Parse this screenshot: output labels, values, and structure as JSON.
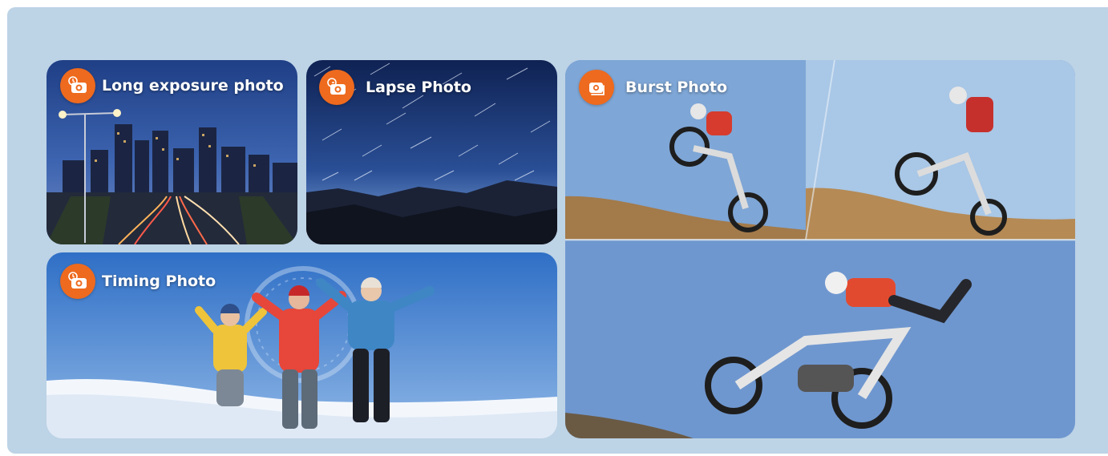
{
  "cards": {
    "long_exposure": {
      "title": "Long exposure photo",
      "icon": "timer-camera-icon"
    },
    "lapse": {
      "title": "Lapse Photo",
      "icon": "timelapse-camera-icon"
    },
    "timing": {
      "title": "Timing Photo",
      "icon": "timer-camera-icon"
    },
    "burst": {
      "title": "Burst Photo",
      "icon": "burst-camera-icon"
    }
  },
  "colors": {
    "panel": "#bdd3e6",
    "badge": "#ee6a1e",
    "label": "#ffffff"
  }
}
